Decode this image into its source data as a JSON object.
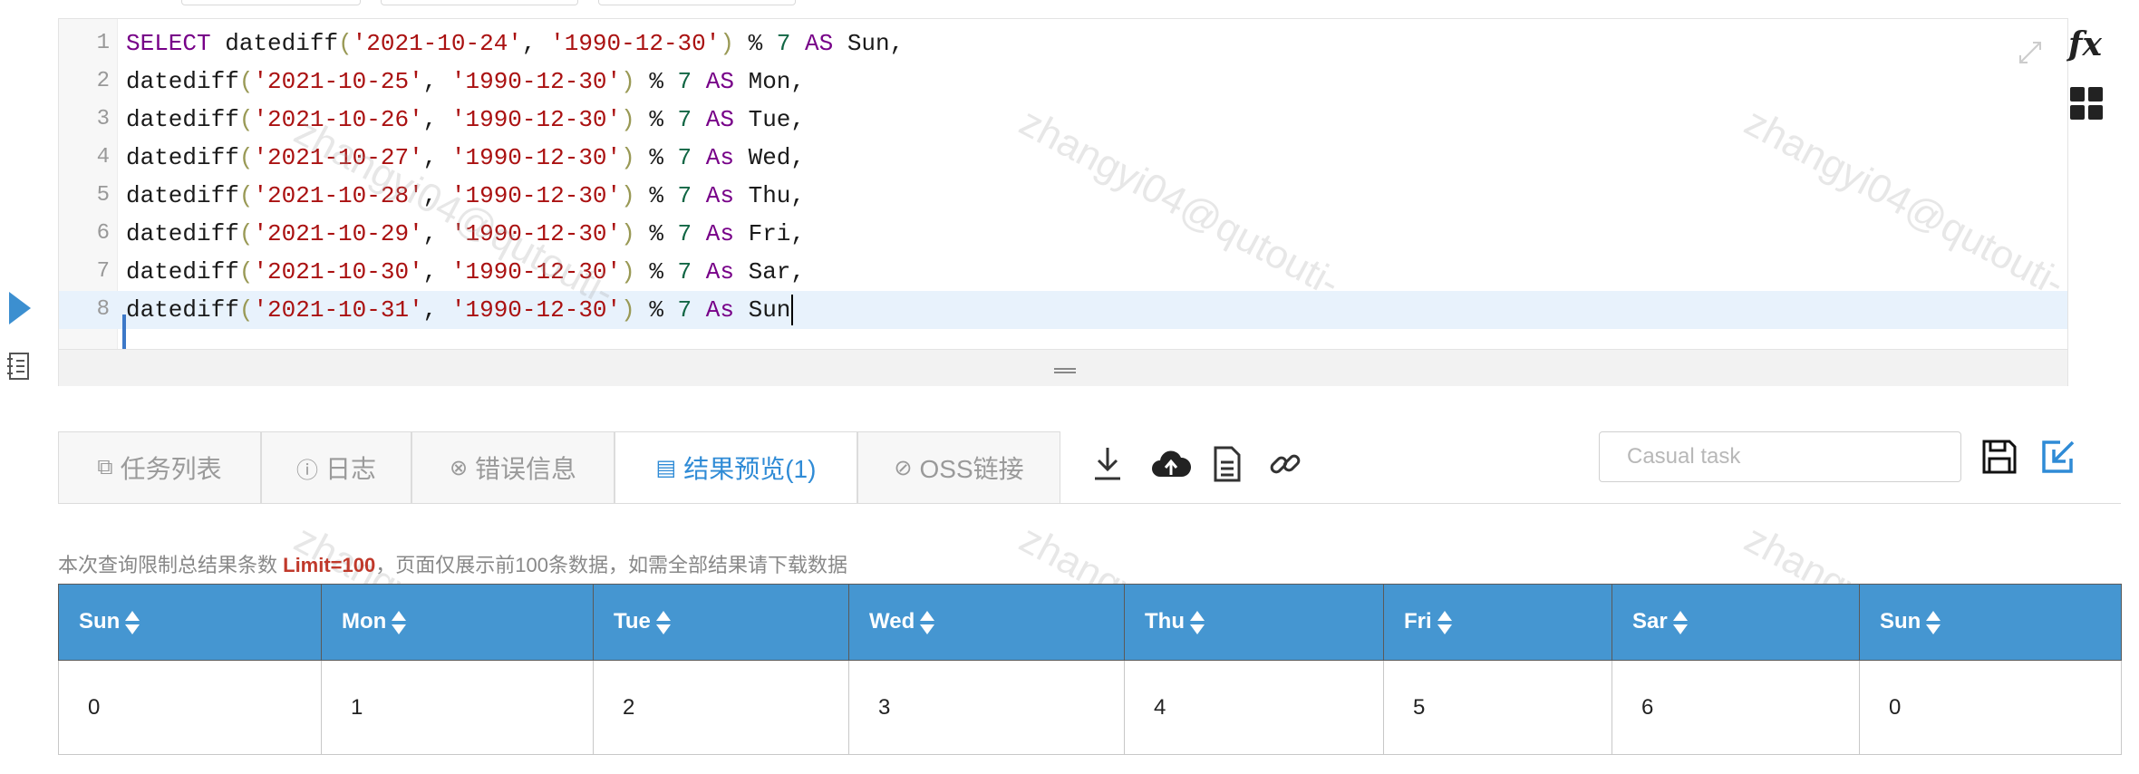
{
  "editor": {
    "lines": [
      {
        "num": "1",
        "tokens": [
          {
            "t": "kw",
            "v": "SELECT"
          },
          {
            "t": "",
            "v": " datediff"
          },
          {
            "t": "paren",
            "v": "("
          },
          {
            "t": "str",
            "v": "'2021-10-24'"
          },
          {
            "t": "",
            "v": ", "
          },
          {
            "t": "str",
            "v": "'1990-12-30'"
          },
          {
            "t": "paren",
            "v": ")"
          },
          {
            "t": "",
            "v": " % "
          },
          {
            "t": "num",
            "v": "7"
          },
          {
            "t": "",
            "v": " "
          },
          {
            "t": "kw",
            "v": "AS"
          },
          {
            "t": "",
            "v": " Sun,"
          }
        ]
      },
      {
        "num": "2",
        "tokens": [
          {
            "t": "",
            "v": "datediff"
          },
          {
            "t": "paren",
            "v": "("
          },
          {
            "t": "str",
            "v": "'2021-10-25'"
          },
          {
            "t": "",
            "v": ", "
          },
          {
            "t": "str",
            "v": "'1990-12-30'"
          },
          {
            "t": "paren",
            "v": ")"
          },
          {
            "t": "",
            "v": " % "
          },
          {
            "t": "num",
            "v": "7"
          },
          {
            "t": "",
            "v": " "
          },
          {
            "t": "kw",
            "v": "AS"
          },
          {
            "t": "",
            "v": " Mon,"
          }
        ]
      },
      {
        "num": "3",
        "tokens": [
          {
            "t": "",
            "v": "datediff"
          },
          {
            "t": "paren",
            "v": "("
          },
          {
            "t": "str",
            "v": "'2021-10-26'"
          },
          {
            "t": "",
            "v": ", "
          },
          {
            "t": "str",
            "v": "'1990-12-30'"
          },
          {
            "t": "paren",
            "v": ")"
          },
          {
            "t": "",
            "v": " % "
          },
          {
            "t": "num",
            "v": "7"
          },
          {
            "t": "",
            "v": " "
          },
          {
            "t": "kw",
            "v": "AS"
          },
          {
            "t": "",
            "v": " Tue,"
          }
        ]
      },
      {
        "num": "4",
        "tokens": [
          {
            "t": "",
            "v": "datediff"
          },
          {
            "t": "paren",
            "v": "("
          },
          {
            "t": "str",
            "v": "'2021-10-27'"
          },
          {
            "t": "",
            "v": ", "
          },
          {
            "t": "str",
            "v": "'1990-12-30'"
          },
          {
            "t": "paren",
            "v": ")"
          },
          {
            "t": "",
            "v": " % "
          },
          {
            "t": "num",
            "v": "7"
          },
          {
            "t": "",
            "v": " "
          },
          {
            "t": "kw",
            "v": "As"
          },
          {
            "t": "",
            "v": " Wed,"
          }
        ]
      },
      {
        "num": "5",
        "tokens": [
          {
            "t": "",
            "v": "datediff"
          },
          {
            "t": "paren",
            "v": "("
          },
          {
            "t": "str",
            "v": "'2021-10-28'"
          },
          {
            "t": "",
            "v": ", "
          },
          {
            "t": "str",
            "v": "'1990-12-30'"
          },
          {
            "t": "paren",
            "v": ")"
          },
          {
            "t": "",
            "v": " % "
          },
          {
            "t": "num",
            "v": "7"
          },
          {
            "t": "",
            "v": " "
          },
          {
            "t": "kw",
            "v": "As"
          },
          {
            "t": "",
            "v": " Thu,"
          }
        ]
      },
      {
        "num": "6",
        "tokens": [
          {
            "t": "",
            "v": "datediff"
          },
          {
            "t": "paren",
            "v": "("
          },
          {
            "t": "str",
            "v": "'2021-10-29'"
          },
          {
            "t": "",
            "v": ", "
          },
          {
            "t": "str",
            "v": "'1990-12-30'"
          },
          {
            "t": "paren",
            "v": ")"
          },
          {
            "t": "",
            "v": " % "
          },
          {
            "t": "num",
            "v": "7"
          },
          {
            "t": "",
            "v": " "
          },
          {
            "t": "kw",
            "v": "As"
          },
          {
            "t": "",
            "v": " Fri,"
          }
        ]
      },
      {
        "num": "7",
        "tokens": [
          {
            "t": "",
            "v": "datediff"
          },
          {
            "t": "paren",
            "v": "("
          },
          {
            "t": "str",
            "v": "'2021-10-30'"
          },
          {
            "t": "",
            "v": ", "
          },
          {
            "t": "str",
            "v": "'1990-12-30'"
          },
          {
            "t": "paren",
            "v": ")"
          },
          {
            "t": "",
            "v": " % "
          },
          {
            "t": "num",
            "v": "7"
          },
          {
            "t": "",
            "v": " "
          },
          {
            "t": "kw",
            "v": "As"
          },
          {
            "t": "",
            "v": " Sar,"
          }
        ]
      },
      {
        "num": "8",
        "tokens": [
          {
            "t": "",
            "v": "datediff"
          },
          {
            "t": "paren",
            "v": "("
          },
          {
            "t": "str",
            "v": "'2021-10-31'"
          },
          {
            "t": "",
            "v": ", "
          },
          {
            "t": "str",
            "v": "'1990-12-30'"
          },
          {
            "t": "paren",
            "v": ")"
          },
          {
            "t": "",
            "v": " % "
          },
          {
            "t": "num",
            "v": "7"
          },
          {
            "t": "",
            "v": " "
          },
          {
            "t": "kw",
            "v": "As"
          },
          {
            "t": "",
            "v": " Sun"
          }
        ]
      }
    ],
    "active_line": 8
  },
  "sidebar": {
    "fx_label": "fx"
  },
  "watermark": "zhangyi04@qutouti-",
  "tabs": [
    {
      "label": "任务列表",
      "icon": "copy-icon",
      "glyph": "⧉"
    },
    {
      "label": "日志",
      "icon": "info-icon",
      "glyph": "ⓘ"
    },
    {
      "label": "错误信息",
      "icon": "error-icon",
      "glyph": "⊗"
    },
    {
      "label": "结果预览(1)",
      "icon": "document-icon",
      "glyph": "▤",
      "active": true
    },
    {
      "label": "OSS链接",
      "icon": "paperclip-icon",
      "glyph": "⊘"
    }
  ],
  "toolbar": {
    "task_placeholder": "Casual task"
  },
  "notice": {
    "prefix": "本次查询限制总结果条数 ",
    "limit": "Limit=100",
    "suffix": "，页面仅展示前100条数据，如需全部结果请下载数据"
  },
  "results": {
    "columns": [
      "Sun",
      "Mon",
      "Tue",
      "Wed",
      "Thu",
      "Fri",
      "Sar",
      "Sun"
    ],
    "rows": [
      [
        "0",
        "1",
        "2",
        "3",
        "4",
        "5",
        "6",
        "0"
      ]
    ]
  },
  "colors": {
    "accent": "#2f8bd6",
    "header_bg": "#4596d1",
    "limit": "#c0392b"
  }
}
